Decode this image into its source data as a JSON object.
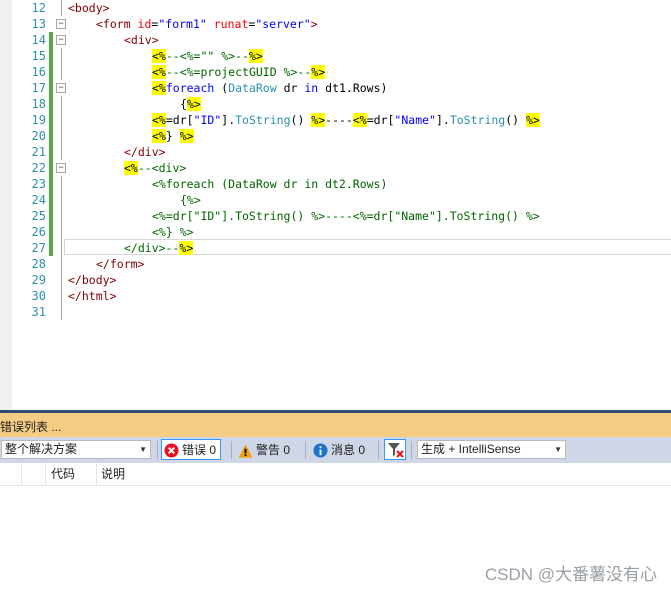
{
  "editor": {
    "lines": [
      {
        "n": "12",
        "indent": 0,
        "segs": [
          [
            "tag",
            "<body>"
          ]
        ],
        "fold": false,
        "chg": false
      },
      {
        "n": "13",
        "indent": 1,
        "segs": [
          [
            "tag",
            "<form "
          ],
          [
            "attr",
            "id"
          ],
          [
            "txt",
            "="
          ],
          [
            "str",
            "\"form1\""
          ],
          [
            "txt",
            " "
          ],
          [
            "attr",
            "runat"
          ],
          [
            "txt",
            "="
          ],
          [
            "str",
            "\"server\""
          ],
          [
            "tag",
            ">"
          ]
        ],
        "fold": true,
        "chg": false
      },
      {
        "n": "14",
        "indent": 2,
        "segs": [
          [
            "tag",
            "<div>"
          ]
        ],
        "fold": true,
        "chg": true
      },
      {
        "n": "15",
        "indent": 3,
        "segs": [
          [
            "del",
            "<%"
          ],
          [
            "cm",
            "--<%=\"\" %>--"
          ],
          [
            "del",
            "%>"
          ]
        ],
        "fold": false,
        "chg": true
      },
      {
        "n": "16",
        "indent": 3,
        "segs": [
          [
            "del",
            "<%"
          ],
          [
            "cm",
            "--<%=projectGUID %>--"
          ],
          [
            "del",
            "%>"
          ]
        ],
        "fold": false,
        "chg": true
      },
      {
        "n": "17",
        "indent": 3,
        "segs": [
          [
            "del",
            "<%"
          ],
          [
            "kw",
            "foreach"
          ],
          [
            "txt",
            " ("
          ],
          [
            "type",
            "DataRow"
          ],
          [
            "txt",
            " dr "
          ],
          [
            "kw",
            "in"
          ],
          [
            "txt",
            " dt1.Rows)"
          ]
        ],
        "fold": true,
        "chg": true
      },
      {
        "n": "18",
        "indent": 4,
        "segs": [
          [
            "txt",
            "{"
          ],
          [
            "del",
            "%>"
          ]
        ],
        "fold": false,
        "chg": true
      },
      {
        "n": "19",
        "indent": 3,
        "segs": [
          [
            "del",
            "<%"
          ],
          [
            "txt",
            "=dr["
          ],
          [
            "str",
            "\"ID\""
          ],
          [
            "txt",
            "]."
          ],
          [
            "type",
            "ToString"
          ],
          [
            "txt",
            "() "
          ],
          [
            "del",
            "%>"
          ],
          [
            "txt",
            "----"
          ],
          [
            "del",
            "<%"
          ],
          [
            "txt",
            "=dr["
          ],
          [
            "str",
            "\"Name\""
          ],
          [
            "txt",
            "]."
          ],
          [
            "type",
            "ToString"
          ],
          [
            "txt",
            "() "
          ],
          [
            "del",
            "%>"
          ]
        ],
        "fold": false,
        "chg": true
      },
      {
        "n": "20",
        "indent": 3,
        "segs": [
          [
            "del",
            "<%"
          ],
          [
            "txt",
            "} "
          ],
          [
            "del",
            "%>"
          ]
        ],
        "fold": false,
        "chg": true
      },
      {
        "n": "21",
        "indent": 2,
        "segs": [
          [
            "tag",
            "</div>"
          ]
        ],
        "fold": false,
        "chg": true
      },
      {
        "n": "22",
        "indent": 2,
        "segs": [
          [
            "del",
            "<%"
          ],
          [
            "cm",
            "--<div>"
          ]
        ],
        "fold": true,
        "chg": true
      },
      {
        "n": "23",
        "indent": 3,
        "segs": [
          [
            "cm",
            "<%foreach (DataRow dr in dt2.Rows)"
          ]
        ],
        "fold": false,
        "chg": true
      },
      {
        "n": "24",
        "indent": 4,
        "segs": [
          [
            "cm",
            "{%>"
          ]
        ],
        "fold": false,
        "chg": true
      },
      {
        "n": "25",
        "indent": 3,
        "segs": [
          [
            "cm",
            "<%=dr[\"ID\"].ToString() %>----<%=dr[\"Name\"].ToString() %>"
          ]
        ],
        "fold": false,
        "chg": true
      },
      {
        "n": "26",
        "indent": 3,
        "segs": [
          [
            "cm",
            "<%} %>"
          ]
        ],
        "fold": false,
        "chg": true
      },
      {
        "n": "27",
        "indent": 2,
        "segs": [
          [
            "cm",
            "</div>--"
          ],
          [
            "del",
            "%>"
          ]
        ],
        "fold": false,
        "chg": true
      },
      {
        "n": "28",
        "indent": 1,
        "segs": [
          [
            "tag",
            "</form>"
          ]
        ],
        "fold": false,
        "chg": false
      },
      {
        "n": "29",
        "indent": 0,
        "segs": [
          [
            "tag",
            "</body>"
          ]
        ],
        "fold": false,
        "chg": false
      },
      {
        "n": "30",
        "indent": 0,
        "segs": [
          [
            "tag",
            "</html>"
          ]
        ],
        "fold": false,
        "chg": false
      },
      {
        "n": "31",
        "indent": 0,
        "segs": [],
        "fold": false,
        "chg": false
      }
    ]
  },
  "panel": {
    "title": "错误列表 ...",
    "scope_select": "整个解决方案",
    "errors_label": "错误 0",
    "warnings_label": "警告 0",
    "messages_label": "消息 0",
    "build_select": "生成 + IntelliSense",
    "col_code": "代码",
    "col_desc": "说明"
  },
  "watermark": "CSDN @大番薯没有心",
  "colors": {
    "error": "#e81123",
    "warning": "#f0a30a",
    "info": "#1e72c7",
    "title_bg": "#f5cc84",
    "toolbar_bg": "#cfd6e5"
  }
}
